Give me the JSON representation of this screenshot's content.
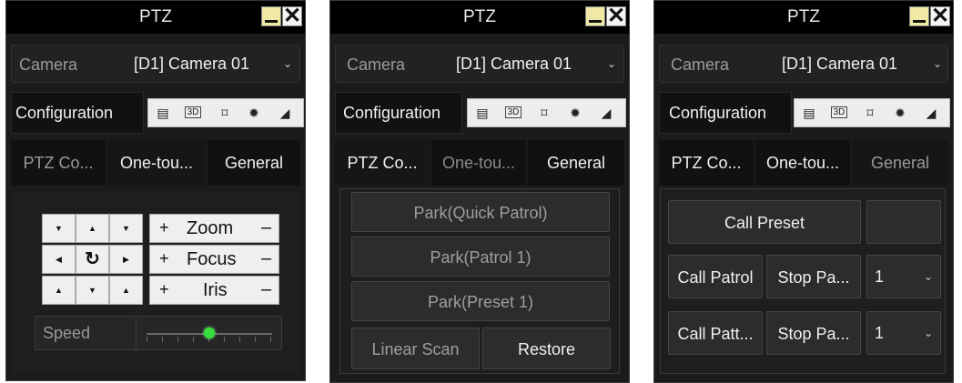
{
  "panels": [
    {
      "title": "PTZ",
      "camera_label": "Camera",
      "camera_value": "[D1] Camera 01",
      "config_label": "Configuration",
      "tabs": [
        "PTZ Co...",
        "One-tou...",
        "General"
      ],
      "pad": {
        "zoom": "Zoom",
        "focus": "Focus",
        "iris": "Iris",
        "plus": "+",
        "minus": "–",
        "speed_label": "Speed",
        "speed_value": 0.5
      }
    },
    {
      "title": "PTZ",
      "camera_label": "Camera",
      "camera_value": "[D1] Camera 01",
      "config_label": "Configuration",
      "tabs": [
        "PTZ Co...",
        "One-tou...",
        "General"
      ],
      "buttons": {
        "park_quick": "Park(Quick Patrol)",
        "park_patrol": "Park(Patrol 1)",
        "park_preset": "Park(Preset 1)",
        "linear_scan": "Linear Scan",
        "restore": "Restore"
      }
    },
    {
      "title": "PTZ",
      "camera_label": "Camera",
      "camera_value": "[D1] Camera 01",
      "config_label": "Configuration",
      "tabs": [
        "PTZ Co...",
        "One-tou...",
        "General"
      ],
      "buttons": {
        "call_preset": "Call Preset",
        "call_patrol": "Call Patrol",
        "stop_patrol": "Stop Pa...",
        "patrol_num": "1",
        "call_pattern": "Call Patt...",
        "stop_pattern": "Stop Pa...",
        "pattern_num": "1"
      }
    }
  ],
  "icons": [
    "list-icon",
    "3d-icon",
    "focus-frame-icon",
    "light-icon",
    "wiper-icon"
  ],
  "colors": {
    "accent_green": "#36e03a",
    "panel_bg": "#1b1b1b",
    "title_bg": "#000000"
  }
}
